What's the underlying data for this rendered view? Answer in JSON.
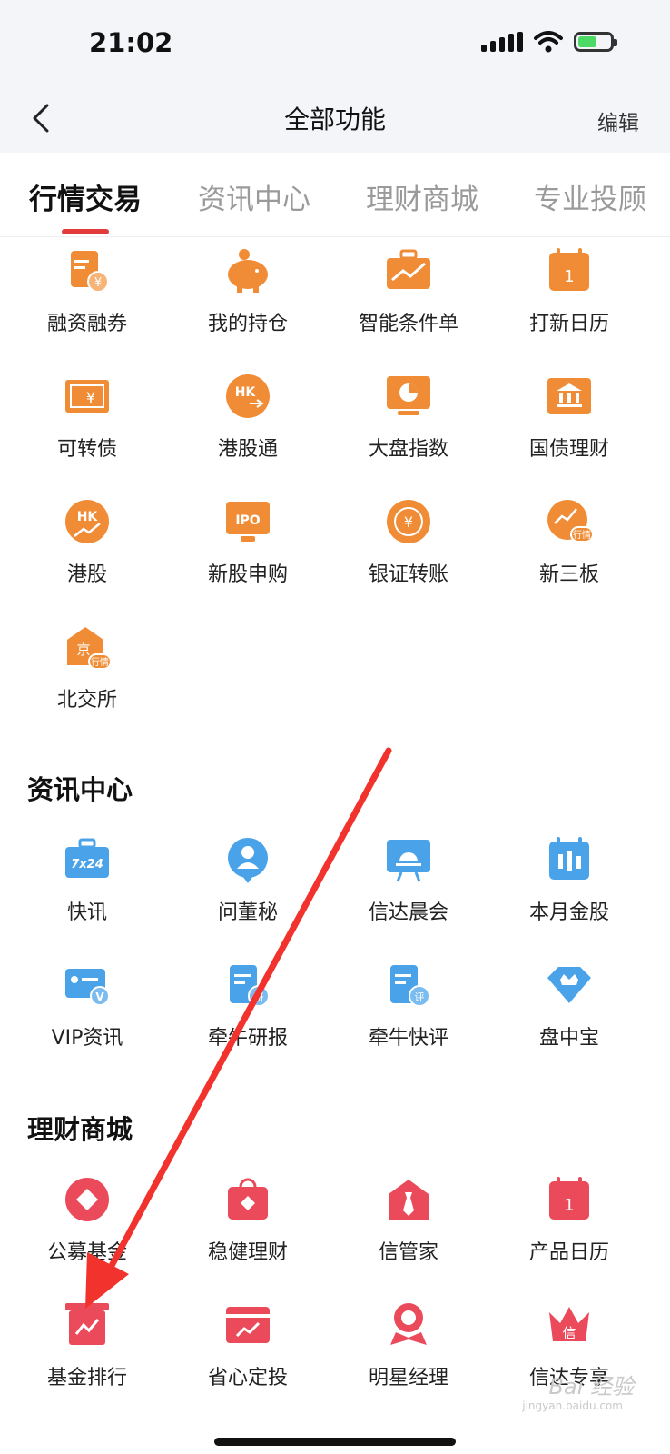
{
  "status": {
    "time": "21:02"
  },
  "nav": {
    "title": "全部功能",
    "edit": "编辑"
  },
  "tabs": [
    {
      "label": "行情交易",
      "active": true
    },
    {
      "label": "资讯中心",
      "active": false
    },
    {
      "label": "理财商城",
      "active": false
    },
    {
      "label": "专业投顾",
      "active": false
    }
  ],
  "colors": {
    "orange": "#f08c35",
    "blue": "#4aa3e8",
    "red": "#ea4a5a",
    "tab_underline": "#e23b3b"
  },
  "sections": {
    "trading": {
      "items": [
        {
          "label": "融资融券",
          "icon": "document-yen-icon"
        },
        {
          "label": "我的持仓",
          "icon": "piggy-bank-icon"
        },
        {
          "label": "智能条件单",
          "icon": "briefcase-chart-icon"
        },
        {
          "label": "打新日历",
          "icon": "calendar-icon",
          "glyph": "1"
        },
        {
          "label": "可转债",
          "icon": "ticket-yen-icon",
          "glyph": "¥"
        },
        {
          "label": "港股通",
          "icon": "hk-connect-icon",
          "glyph": "HK"
        },
        {
          "label": "大盘指数",
          "icon": "monitor-pie-icon"
        },
        {
          "label": "国债理财",
          "icon": "bank-icon"
        },
        {
          "label": "港股",
          "icon": "hk-trend-icon",
          "glyph": "HK"
        },
        {
          "label": "新股申购",
          "icon": "ipo-icon",
          "glyph": "IPO"
        },
        {
          "label": "银证转账",
          "icon": "yen-transfer-icon",
          "glyph": "¥"
        },
        {
          "label": "新三板",
          "icon": "new-board-icon",
          "glyph": "行情"
        },
        {
          "label": "北交所",
          "icon": "beijing-exchange-icon",
          "glyph": "京",
          "glyph2": "行情"
        }
      ]
    },
    "news": {
      "title": "资讯中心",
      "items": [
        {
          "label": "快讯",
          "icon": "bag-7x24-icon",
          "glyph": "7x24"
        },
        {
          "label": "问董秘",
          "icon": "person-bubble-icon"
        },
        {
          "label": "信达晨会",
          "icon": "presentation-sunrise-icon"
        },
        {
          "label": "本月金股",
          "icon": "calendar-candles-icon"
        },
        {
          "label": "VIP资讯",
          "icon": "vip-card-icon",
          "glyph": "V"
        },
        {
          "label": "牵牛研报",
          "icon": "doc-research-icon",
          "glyph": "研"
        },
        {
          "label": "牵牛快评",
          "icon": "doc-review-icon",
          "glyph": "评"
        },
        {
          "label": "盘中宝",
          "icon": "diamond-crown-icon"
        }
      ]
    },
    "mall": {
      "title": "理财商城",
      "items": [
        {
          "label": "公募基金",
          "icon": "diamond-circle-icon"
        },
        {
          "label": "稳健理财",
          "icon": "bag-diamond-icon"
        },
        {
          "label": "信管家",
          "icon": "house-tie-icon"
        },
        {
          "label": "产品日历",
          "icon": "calendar-red-icon",
          "glyph": "1"
        },
        {
          "label": "基金排行",
          "icon": "box-trend-icon"
        },
        {
          "label": "省心定投",
          "icon": "card-trend-icon"
        },
        {
          "label": "明星经理",
          "icon": "star-manager-icon"
        },
        {
          "label": "信达专享",
          "icon": "crown-exclusive-icon",
          "glyph": "信"
        }
      ]
    }
  },
  "watermark": {
    "brand": "Bai 经验",
    "url": "jingyan.baidu.com"
  }
}
